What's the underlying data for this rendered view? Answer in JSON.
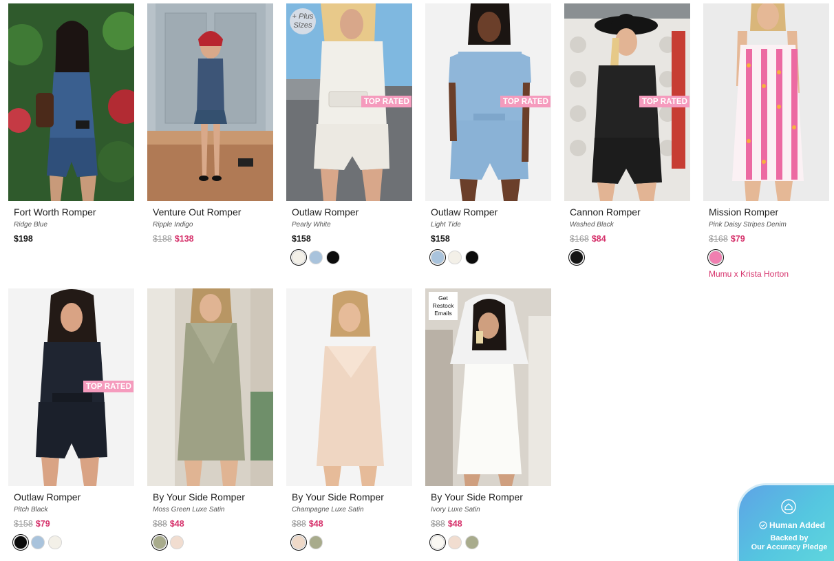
{
  "products": [
    {
      "name": "Fort Worth Romper",
      "color": "Ridge Blue",
      "price": "$198",
      "old_price": "",
      "sale_price": "",
      "badge": "",
      "swatches": []
    },
    {
      "name": "Venture Out Romper",
      "color": "Ripple Indigo",
      "price": "",
      "old_price": "$188",
      "sale_price": "$138",
      "badge": "",
      "swatches": []
    },
    {
      "name": "Outlaw Romper",
      "color": "Pearly White",
      "price": "$158",
      "old_price": "",
      "sale_price": "",
      "badge": "TOP RATED",
      "plus_label": "+ Plus Sizes",
      "swatches": [
        "#f3f0e8",
        "#a9c3dc",
        "#0b0b0b"
      ],
      "selected_swatch": 0
    },
    {
      "name": "Outlaw Romper",
      "color": "Light Tide",
      "price": "$158",
      "old_price": "",
      "sale_price": "",
      "badge": "TOP RATED",
      "swatches": [
        "#a9c3dc",
        "#f3f0e8",
        "#0b0b0b"
      ],
      "selected_swatch": 0
    },
    {
      "name": "Cannon Romper",
      "color": "Washed Black",
      "price": "",
      "old_price": "$168",
      "sale_price": "$84",
      "badge": "TOP RATED",
      "swatches": [
        "#141414"
      ],
      "selected_swatch": 0
    },
    {
      "name": "Mission Romper",
      "color": "Pink Daisy Stripes Denim",
      "price": "",
      "old_price": "$168",
      "sale_price": "$79",
      "badge": "",
      "swatches": [
        "#f07fb0"
      ],
      "selected_swatch": 0,
      "collab": "Mumu x Krista Horton"
    },
    {
      "name": "Outlaw Romper",
      "color": "Pitch Black",
      "price": "",
      "old_price": "$158",
      "sale_price": "$79",
      "badge": "TOP RATED",
      "swatches": [
        "#0b0b0b",
        "#a9c3dc",
        "#f3f0e8"
      ],
      "selected_swatch": 0
    },
    {
      "name": "By Your Side Romper",
      "color": "Moss Green Luxe Satin",
      "price": "",
      "old_price": "$88",
      "sale_price": "$48",
      "badge": "",
      "swatches": [
        "#a8ab8c",
        "#f1ddd0"
      ],
      "selected_swatch": 0
    },
    {
      "name": "By Your Side Romper",
      "color": "Champagne Luxe Satin",
      "price": "",
      "old_price": "$88",
      "sale_price": "$48",
      "badge": "",
      "swatches": [
        "#efd9c8",
        "#a8ab8c"
      ],
      "selected_swatch": 0
    },
    {
      "name": "By Your Side Romper",
      "color": "Ivory Luxe Satin",
      "price": "",
      "old_price": "$88",
      "sale_price": "$48",
      "badge": "",
      "restock_label": "Get Restock Emails",
      "swatches": [
        "#faf8f3",
        "#f1ddd0",
        "#a8ab8c"
      ],
      "selected_swatch": 0
    }
  ],
  "pledge": {
    "title": "Human Added",
    "line1": "Backed by",
    "line2": "Our Accuracy Pledge",
    "icon": "home-check-icon"
  },
  "colors": {
    "accent_pink": "#d6336c",
    "badge_pink": "#f59bbd",
    "pledge_blue": "#5ea3e6"
  }
}
